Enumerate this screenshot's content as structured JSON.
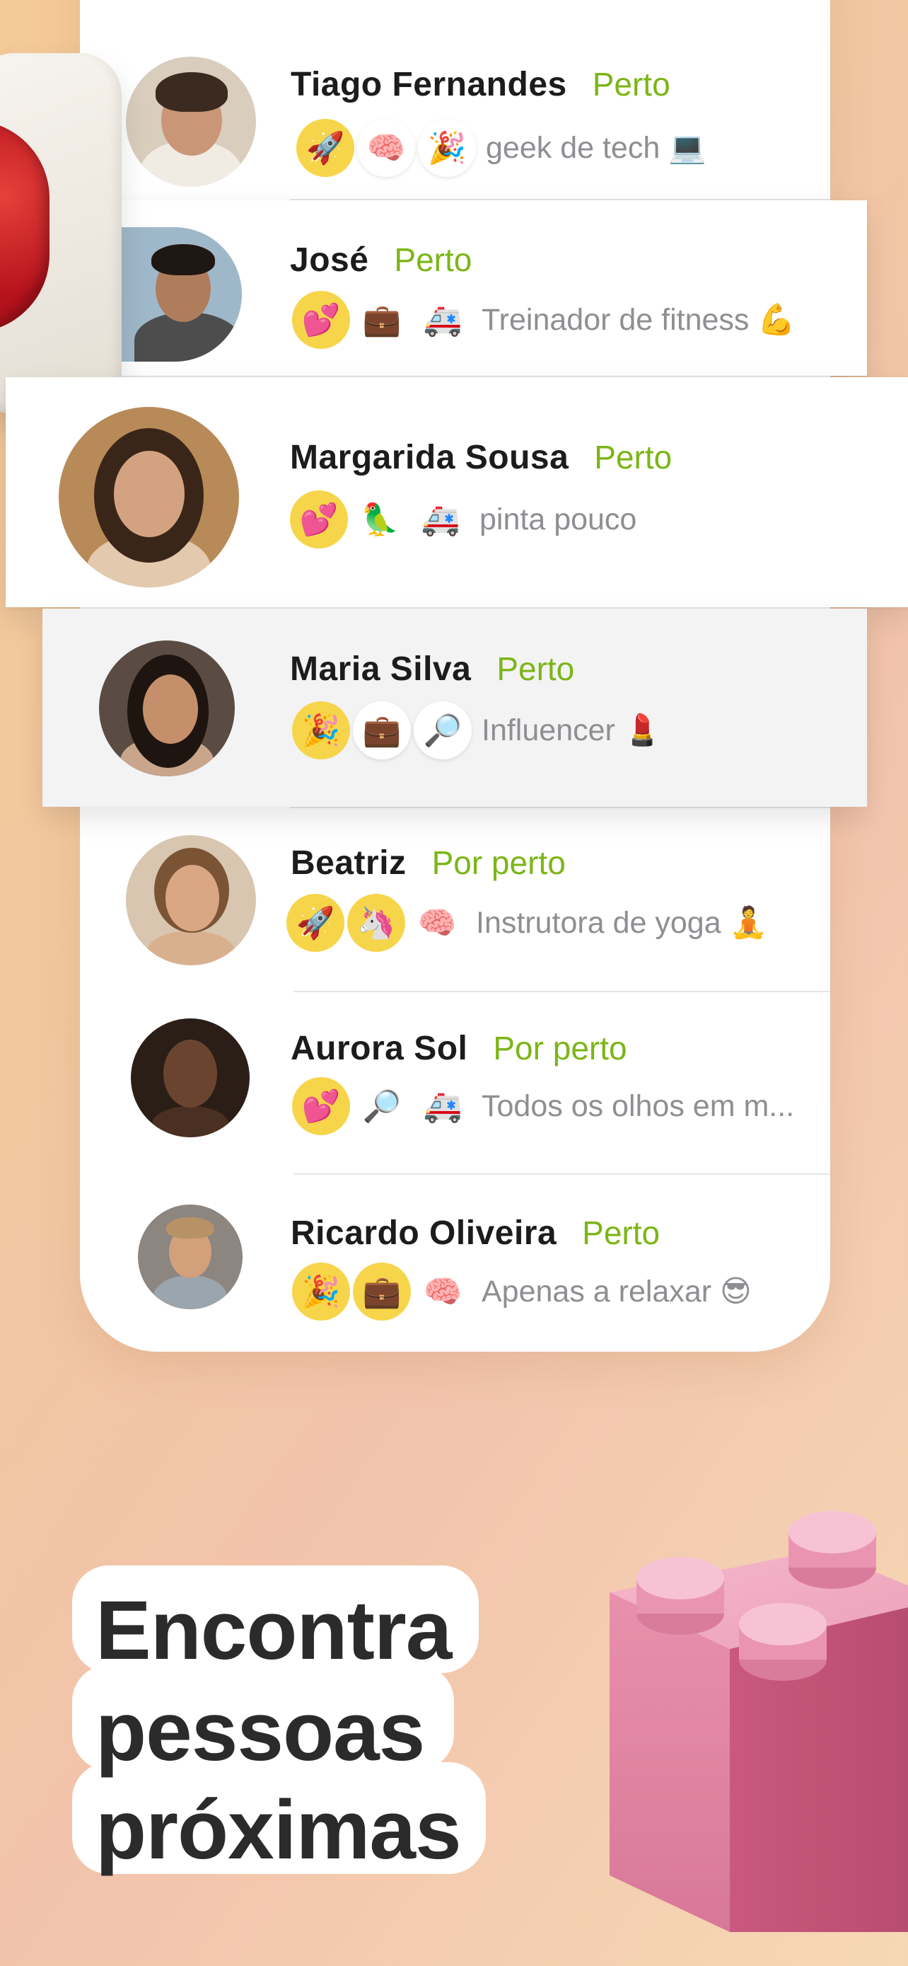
{
  "profiles": [
    {
      "name": "Tiago Fernandes",
      "status": "Perto",
      "badges": [
        "🚀",
        "🧠",
        "🎉"
      ],
      "bio": "geek de tech 💻"
    },
    {
      "name": "José",
      "status": "Perto",
      "badges": [
        "💕",
        "💼",
        "🚑"
      ],
      "bio": "Treinador de fitness 💪"
    },
    {
      "name": "Margarida Sousa",
      "status": "Perto",
      "badges": [
        "💕",
        "🦜",
        "🚑"
      ],
      "bio": "pinta pouco"
    },
    {
      "name": "Maria Silva",
      "status": "Perto",
      "badges": [
        "🎉",
        "💼",
        "🔎"
      ],
      "bio": "Influencer 💄"
    },
    {
      "name": "Beatriz",
      "status": "Por perto",
      "badges": [
        "🚀",
        "🦄",
        "🧠"
      ],
      "bio": "Instrutora de yoga 🧘"
    },
    {
      "name": "Aurora Sol",
      "status": "Por perto",
      "badges": [
        "💕",
        "🔎",
        "🚑"
      ],
      "bio": "Todos os olhos em m..."
    },
    {
      "name": "Ricardo Oliveira",
      "status": "Perto",
      "badges": [
        "🎉",
        "💼",
        "🧠"
      ],
      "bio": "Apenas a relaxar 😎"
    }
  ],
  "headline": {
    "line1": "Encontra",
    "line2": "pessoas",
    "line3": "próximas"
  },
  "colors": {
    "status_green": "#7cb518",
    "badge_yellow": "#f7d54a",
    "text_dark": "#1c1c1e",
    "text_grey": "#8e8e93"
  }
}
